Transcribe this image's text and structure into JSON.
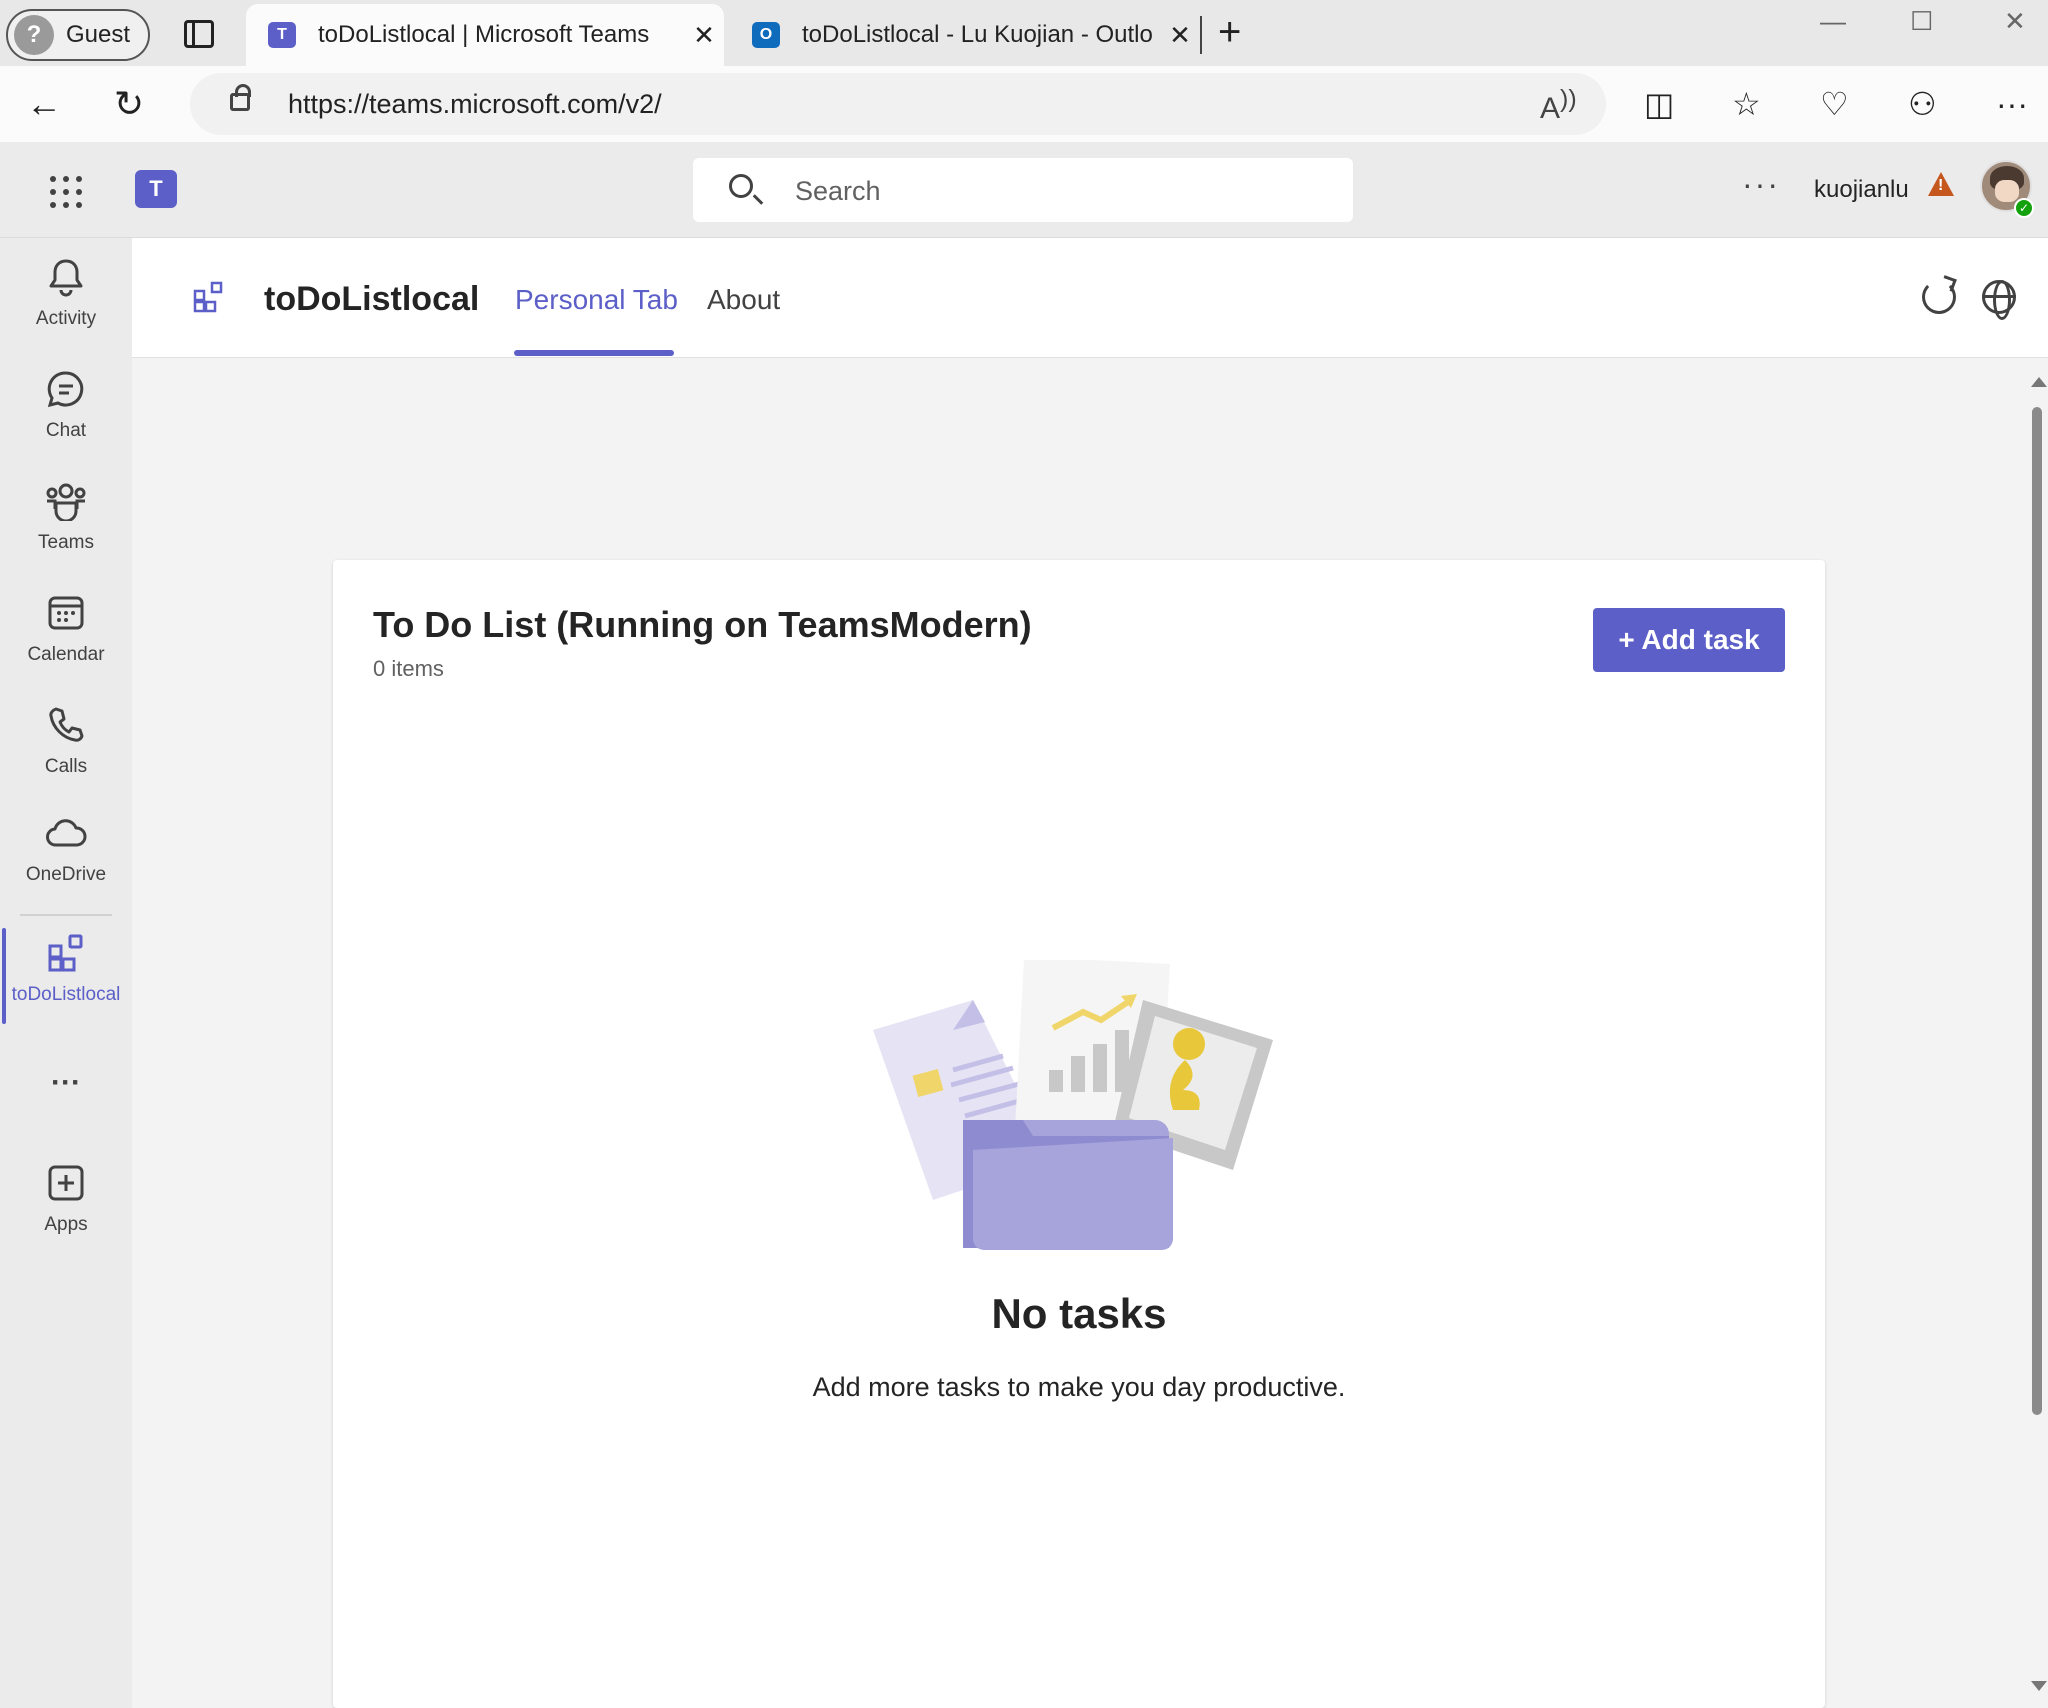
{
  "browser": {
    "profile_label": "Guest",
    "tabs": [
      {
        "title": "toDoListlocal | Microsoft Teams",
        "icon": "teams-icon"
      },
      {
        "title": "toDoListlocal - Lu Kuojian - Outlo",
        "icon": "outlook-icon"
      }
    ],
    "url": "https://teams.microsoft.com/v2/"
  },
  "teams_header": {
    "search_placeholder": "Search",
    "username": "kuojianlu"
  },
  "rail": {
    "items": [
      {
        "label": "Activity",
        "icon": "bell-icon"
      },
      {
        "label": "Chat",
        "icon": "chat-icon"
      },
      {
        "label": "Teams",
        "icon": "teams-people-icon"
      },
      {
        "label": "Calendar",
        "icon": "calendar-icon"
      },
      {
        "label": "Calls",
        "icon": "phone-icon"
      },
      {
        "label": "OneDrive",
        "icon": "cloud-icon"
      },
      {
        "label": "toDoListlocal",
        "icon": "app-grid-icon"
      },
      {
        "label": "Apps",
        "icon": "add-app-icon"
      }
    ],
    "more_label": "···"
  },
  "app": {
    "title": "toDoListlocal",
    "tabs": [
      {
        "label": "Personal Tab",
        "active": true
      },
      {
        "label": "About",
        "active": false
      }
    ]
  },
  "card": {
    "title": "To Do List (Running on TeamsModern)",
    "count": "0 items",
    "add_button": "+ Add task",
    "empty_title": "No tasks",
    "empty_subtitle": "Add more tasks to make you day productive."
  },
  "colors": {
    "brand": "#5b5fc7",
    "warning": "#c4561e",
    "presence": "#13a10e"
  }
}
